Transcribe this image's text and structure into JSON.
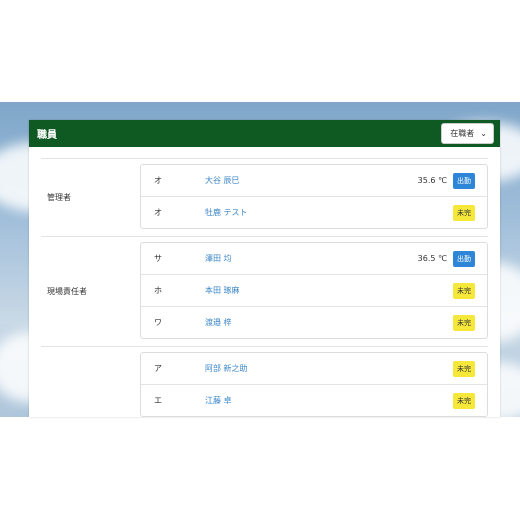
{
  "header": {
    "title": "職員",
    "filter": {
      "selected": "在職者"
    }
  },
  "groups": [
    {
      "label": "管理者",
      "members": [
        {
          "kana": "オ",
          "name": "大谷 辰巳",
          "temp": "35.6 ℃",
          "status": "出勤",
          "status_type": "in"
        },
        {
          "kana": "オ",
          "name": "牡鹿 テスト",
          "temp": "",
          "status": "未完",
          "status_type": "no"
        }
      ]
    },
    {
      "label": "現場責任者",
      "members": [
        {
          "kana": "サ",
          "name": "澤田 均",
          "temp": "36.5 ℃",
          "status": "出勤",
          "status_type": "in"
        },
        {
          "kana": "ホ",
          "name": "本田 琢麻",
          "temp": "",
          "status": "未完",
          "status_type": "no"
        },
        {
          "kana": "ワ",
          "name": "渡邉 梓",
          "temp": "",
          "status": "未完",
          "status_type": "no"
        }
      ]
    },
    {
      "label": "",
      "members": [
        {
          "kana": "ア",
          "name": "阿部 新之助",
          "temp": "",
          "status": "未完",
          "status_type": "no"
        },
        {
          "kana": "エ",
          "name": "江藤 卓",
          "temp": "",
          "status": "未完",
          "status_type": "no"
        }
      ]
    }
  ],
  "colors": {
    "header_bg": "#0e5a22",
    "name_link": "#3a86c8",
    "badge_in": "#2f86d6",
    "badge_pending": "#f5e83a"
  }
}
